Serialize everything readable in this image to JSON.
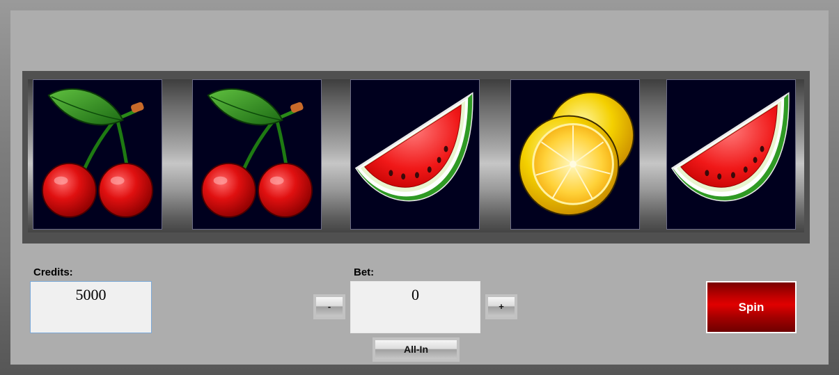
{
  "reels": [
    {
      "symbol": "cherry"
    },
    {
      "symbol": "cherry"
    },
    {
      "symbol": "watermelon"
    },
    {
      "symbol": "lemon"
    },
    {
      "symbol": "watermelon"
    }
  ],
  "credits": {
    "label": "Credits:",
    "value": "5000"
  },
  "bet": {
    "label": "Bet:",
    "value": "0",
    "decrease_label": "-",
    "increase_label": "+"
  },
  "all_in_label": "All-In",
  "spin_label": "Spin",
  "colors": {
    "spin_button": "#c40000",
    "reel_background": "#00001e",
    "panel": "#adadad"
  }
}
